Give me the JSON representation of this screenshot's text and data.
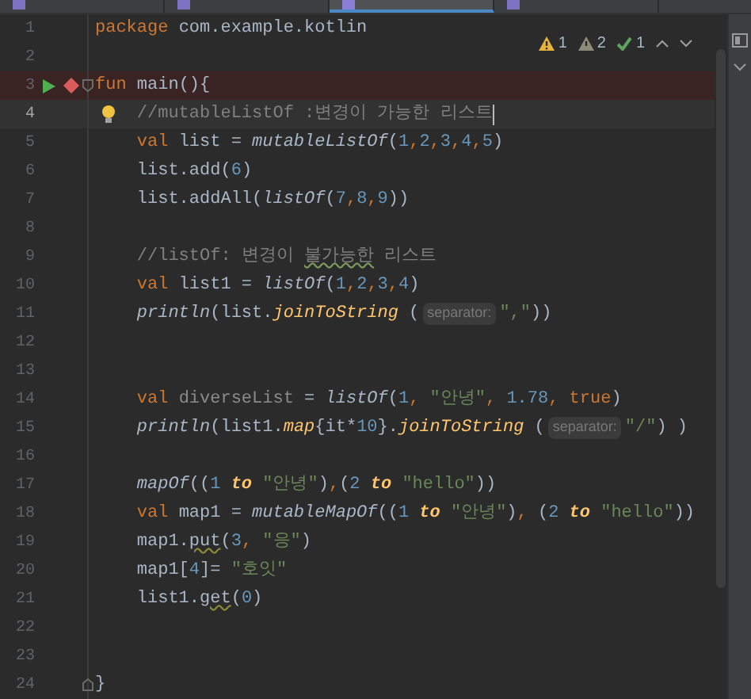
{
  "tabs": [
    {
      "selected": false
    },
    {
      "selected": false
    },
    {
      "selected": true
    },
    {
      "selected": false
    }
  ],
  "inspections": [
    {
      "kind": "error",
      "count": "1"
    },
    {
      "kind": "warning",
      "count": "2"
    },
    {
      "kind": "typo",
      "count": "1"
    }
  ],
  "lines": [
    {
      "number": "1",
      "kind": "plain",
      "tokens": [
        {
          "text": "package",
          "kind": "kw"
        },
        {
          "text": " com.example.kotlin",
          "kind": "plain"
        }
      ]
    },
    {
      "number": "2",
      "kind": "plain"
    },
    {
      "number": "3",
      "kind": "run_breakpoint",
      "tokens": [
        {
          "text": "fun",
          "kind": "kw"
        },
        {
          "text": " main(){",
          "kind": "plain"
        }
      ]
    },
    {
      "number": "4",
      "kind": "caret",
      "tokens": [
        {
          "text": "    //mutableListOf :변경이 가능한 리스트",
          "kind": "comment"
        }
      ]
    },
    {
      "number": "5",
      "kind": "plain",
      "tokens": [
        {
          "text": "    val",
          "kind": "kw"
        },
        {
          "text": " list = ",
          "kind": "plain"
        },
        {
          "text": "mutableListOf",
          "kind": "fn"
        },
        {
          "text": "(",
          "kind": "plain"
        },
        {
          "text": "1",
          "kind": "num"
        },
        {
          "text": ",",
          "kind": "kw"
        },
        {
          "text": "2",
          "kind": "num"
        },
        {
          "text": ",",
          "kind": "kw"
        },
        {
          "text": "3",
          "kind": "num"
        },
        {
          "text": ",",
          "kind": "kw"
        },
        {
          "text": "4",
          "kind": "num"
        },
        {
          "text": ",",
          "kind": "kw"
        },
        {
          "text": "5",
          "kind": "num"
        },
        {
          "text": ")",
          "kind": "plain"
        }
      ]
    },
    {
      "number": "6",
      "kind": "plain",
      "tokens": [
        {
          "text": "    list.add(",
          "kind": "plain"
        },
        {
          "text": "6",
          "kind": "num"
        },
        {
          "text": ")",
          "kind": "plain"
        }
      ]
    },
    {
      "number": "7",
      "kind": "plain",
      "tokens": [
        {
          "text": "    list.addAll(",
          "kind": "plain"
        },
        {
          "text": "listOf",
          "kind": "fn"
        },
        {
          "text": "(",
          "kind": "plain"
        },
        {
          "text": "7",
          "kind": "num"
        },
        {
          "text": ",",
          "kind": "kw"
        },
        {
          "text": "8",
          "kind": "num"
        },
        {
          "text": ",",
          "kind": "kw"
        },
        {
          "text": "9",
          "kind": "num"
        },
        {
          "text": "))",
          "kind": "plain"
        }
      ]
    },
    {
      "number": "8",
      "kind": "plain"
    },
    {
      "number": "9",
      "kind": "plain",
      "tokens": [
        {
          "text": "    //listOf: 변경이 ",
          "kind": "comment"
        },
        {
          "text": "불가능한",
          "kind": "typo"
        },
        {
          "text": " 리스트",
          "kind": "comment"
        }
      ]
    },
    {
      "number": "10",
      "kind": "plain",
      "tokens": [
        {
          "text": "    val",
          "kind": "kw"
        },
        {
          "text": " list1 = ",
          "kind": "plain"
        },
        {
          "text": "listOf",
          "kind": "fn"
        },
        {
          "text": "(",
          "kind": "plain"
        },
        {
          "text": "1",
          "kind": "num"
        },
        {
          "text": ",",
          "kind": "kw"
        },
        {
          "text": "2",
          "kind": "num"
        },
        {
          "text": ",",
          "kind": "kw"
        },
        {
          "text": "3",
          "kind": "num"
        },
        {
          "text": ",",
          "kind": "kw"
        },
        {
          "text": "4",
          "kind": "num"
        },
        {
          "text": ")",
          "kind": "plain"
        }
      ]
    },
    {
      "number": "11",
      "kind": "plain",
      "tokens": [
        {
          "text": "    println",
          "kind": "fn"
        },
        {
          "text": "(list.",
          "kind": "plain"
        },
        {
          "text": "joinToString",
          "kind": "ext"
        },
        {
          "text": " (",
          "kind": "plain"
        },
        {
          "text": "separator:",
          "kind": "hint"
        },
        {
          "text": "\",\"",
          "kind": "str"
        },
        {
          "text": "))",
          "kind": "plain"
        }
      ]
    },
    {
      "number": "12",
      "kind": "plain"
    },
    {
      "number": "13",
      "kind": "plain"
    },
    {
      "number": "14",
      "kind": "plain",
      "tokens": [
        {
          "text": "    val",
          "kind": "kw"
        },
        {
          "text": " diverseList",
          "kind": "unused"
        },
        {
          "text": " = ",
          "kind": "plain"
        },
        {
          "text": "listOf",
          "kind": "fn"
        },
        {
          "text": "(",
          "kind": "plain"
        },
        {
          "text": "1",
          "kind": "num"
        },
        {
          "text": ", ",
          "kind": "kw"
        },
        {
          "text": "\"안녕\"",
          "kind": "str"
        },
        {
          "text": ", ",
          "kind": "kw"
        },
        {
          "text": "1.78",
          "kind": "num"
        },
        {
          "text": ", ",
          "kind": "kw"
        },
        {
          "text": "true",
          "kind": "kw"
        },
        {
          "text": ")",
          "kind": "plain"
        }
      ]
    },
    {
      "number": "15",
      "kind": "plain",
      "tokens": [
        {
          "text": "    println",
          "kind": "fn"
        },
        {
          "text": "(list1.",
          "kind": "plain"
        },
        {
          "text": "map",
          "kind": "ext"
        },
        {
          "text": "{it*",
          "kind": "plain"
        },
        {
          "text": "10",
          "kind": "num"
        },
        {
          "text": "}.",
          "kind": "plain"
        },
        {
          "text": "joinToString",
          "kind": "ext"
        },
        {
          "text": " (",
          "kind": "plain"
        },
        {
          "text": "separator:",
          "kind": "hint"
        },
        {
          "text": "\"/\"",
          "kind": "str"
        },
        {
          "text": ") )",
          "kind": "plain"
        }
      ]
    },
    {
      "number": "16",
      "kind": "plain"
    },
    {
      "number": "17",
      "kind": "plain",
      "tokens": [
        {
          "text": "    mapOf",
          "kind": "fn"
        },
        {
          "text": "((",
          "kind": "plain"
        },
        {
          "text": "1",
          "kind": "num"
        },
        {
          "text": " to ",
          "kind": "infix"
        },
        {
          "text": "\"안녕\"",
          "kind": "str"
        },
        {
          "text": ")",
          "kind": "plain"
        },
        {
          "text": ",",
          "kind": "kw"
        },
        {
          "text": "(",
          "kind": "plain"
        },
        {
          "text": "2",
          "kind": "num"
        },
        {
          "text": " to ",
          "kind": "infix"
        },
        {
          "text": "\"hello\"",
          "kind": "str"
        },
        {
          "text": "))",
          "kind": "plain"
        }
      ]
    },
    {
      "number": "18",
      "kind": "plain",
      "tokens": [
        {
          "text": "    val",
          "kind": "kw"
        },
        {
          "text": " map1 = ",
          "kind": "plain"
        },
        {
          "text": "mutableMapOf",
          "kind": "fn"
        },
        {
          "text": "((",
          "kind": "plain"
        },
        {
          "text": "1",
          "kind": "num"
        },
        {
          "text": " to ",
          "kind": "infix"
        },
        {
          "text": "\"안녕\"",
          "kind": "str"
        },
        {
          "text": ")",
          "kind": "plain"
        },
        {
          "text": ", ",
          "kind": "kw"
        },
        {
          "text": "(",
          "kind": "plain"
        },
        {
          "text": "2",
          "kind": "num"
        },
        {
          "text": " to ",
          "kind": "infix"
        },
        {
          "text": "\"hello\"",
          "kind": "str"
        },
        {
          "text": "))",
          "kind": "plain"
        }
      ]
    },
    {
      "number": "19",
      "kind": "plain",
      "tokens": [
        {
          "text": "    map1.",
          "kind": "plain"
        },
        {
          "text": "put",
          "kind": "warn"
        },
        {
          "text": "(",
          "kind": "plain"
        },
        {
          "text": "3",
          "kind": "num"
        },
        {
          "text": ", ",
          "kind": "kw"
        },
        {
          "text": "\"응\"",
          "kind": "str"
        },
        {
          "text": ")",
          "kind": "plain"
        }
      ]
    },
    {
      "number": "20",
      "kind": "plain",
      "tokens": [
        {
          "text": "    map1[",
          "kind": "plain"
        },
        {
          "text": "4",
          "kind": "num"
        },
        {
          "text": "]= ",
          "kind": "plain"
        },
        {
          "text": "\"호잇\"",
          "kind": "str"
        }
      ]
    },
    {
      "number": "21",
      "kind": "plain",
      "tokens": [
        {
          "text": "    list1.",
          "kind": "plain"
        },
        {
          "text": "get",
          "kind": "warn"
        },
        {
          "text": "(",
          "kind": "plain"
        },
        {
          "text": "0",
          "kind": "num"
        },
        {
          "text": ")",
          "kind": "plain"
        }
      ]
    },
    {
      "number": "22",
      "kind": "plain"
    },
    {
      "number": "23",
      "kind": "plain"
    },
    {
      "number": "24",
      "kind": "fold_end",
      "tokens": [
        {
          "text": "}",
          "kind": "plain"
        }
      ]
    }
  ]
}
